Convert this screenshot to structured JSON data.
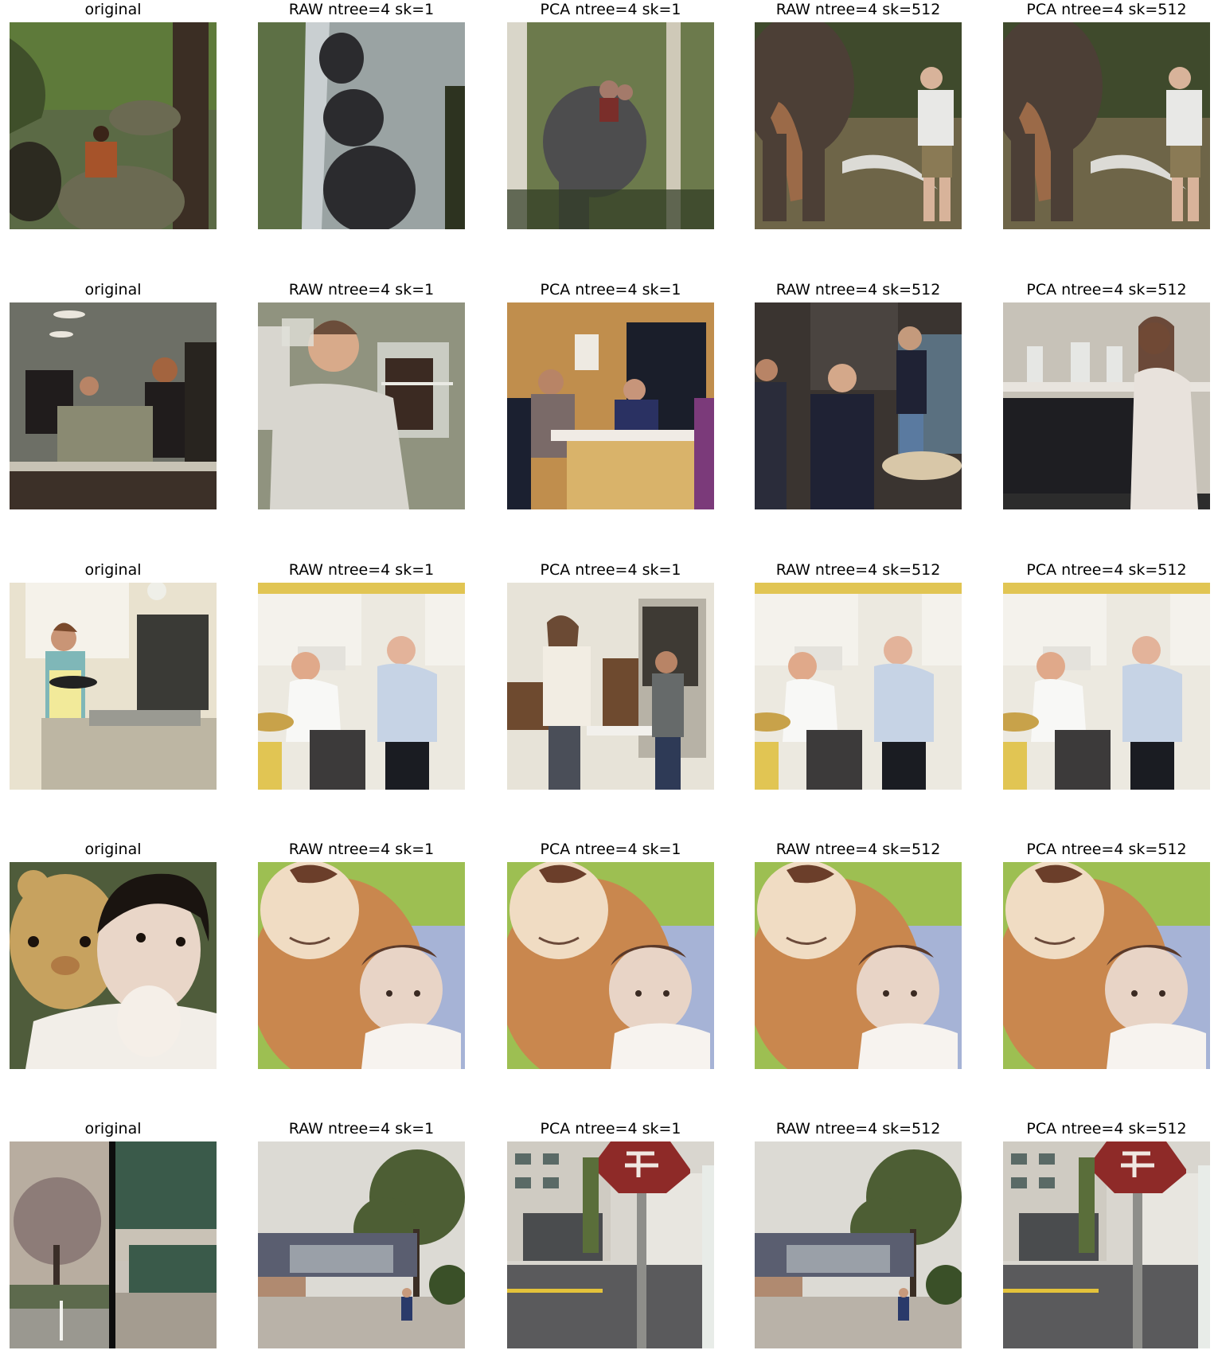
{
  "figure": {
    "rows": [
      {
        "cells": [
          {
            "title": "original",
            "scene": "elephant-river-rider",
            "palette": [
              "#5e7a3a",
              "#3f4f2a",
              "#6b6a52",
              "#a6532a"
            ]
          },
          {
            "title": "RAW ntree=4 sk=1",
            "scene": "bears-river",
            "palette": [
              "#9aa3a3",
              "#2b2b2e",
              "#5d7045",
              "#c9cfd1"
            ]
          },
          {
            "title": "PCA ntree=4 sk=1",
            "scene": "elephant-forest-riders",
            "palette": [
              "#6c7a4c",
              "#4d4d4e",
              "#2f3a24",
              "#a47a6a"
            ]
          },
          {
            "title": "RAW ntree=4 sk=512",
            "scene": "elephant-man-pond",
            "palette": [
              "#6e6548",
              "#4c3f36",
              "#e8e8e6",
              "#8a7a55"
            ]
          },
          {
            "title": "PCA ntree=4 sk=512",
            "scene": "elephant-man-pond",
            "palette": [
              "#6e6548",
              "#4c3f36",
              "#e8e8e6",
              "#8a7a55"
            ]
          }
        ]
      },
      {
        "cells": [
          {
            "title": "original",
            "scene": "kitchen-counter",
            "palette": [
              "#6d6f66",
              "#201c1c",
              "#c8c3b5",
              "#3c3028"
            ]
          },
          {
            "title": "RAW ntree=4 sk=1",
            "scene": "man-drinking",
            "palette": [
              "#90937f",
              "#d8d6cf",
              "#6b4d3a",
              "#3b2a22"
            ]
          },
          {
            "title": "PCA ntree=4 sk=1",
            "scene": "wood-kitchen-party",
            "palette": [
              "#c08e4d",
              "#d9b36a",
              "#1a1e2a",
              "#7a6a68"
            ]
          },
          {
            "title": "RAW ntree=4 sk=512",
            "scene": "group-indoor",
            "palette": [
              "#3a3430",
              "#1f2234",
              "#9b8a7a",
              "#d8c7a8"
            ]
          },
          {
            "title": "PCA ntree=4 sk=512",
            "scene": "woman-oven",
            "palette": [
              "#c7c2b8",
              "#1e1e22",
              "#e8e2dc",
              "#6b5d52"
            ]
          }
        ]
      },
      {
        "cells": [
          {
            "title": "original",
            "scene": "woman-white-kitchen",
            "palette": [
              "#e9e2cf",
              "#bdb6a3",
              "#7fb7b8",
              "#d6d3c7"
            ]
          },
          {
            "title": "RAW ntree=4 sk=1",
            "scene": "couple-yellow-kitchen",
            "palette": [
              "#ece9e0",
              "#e1c553",
              "#3c3a3a",
              "#c6d3e5"
            ]
          },
          {
            "title": "PCA ntree=4 sk=1",
            "scene": "girl-drinking-room",
            "palette": [
              "#e7e3d8",
              "#6e4a2f",
              "#f2ede3",
              "#666a6a"
            ]
          },
          {
            "title": "RAW ntree=4 sk=512",
            "scene": "couple-yellow-kitchen",
            "palette": [
              "#ece9e0",
              "#e1c553",
              "#3c3a3a",
              "#c6d3e5"
            ]
          },
          {
            "title": "PCA ntree=4 sk=512",
            "scene": "couple-yellow-kitchen",
            "palette": [
              "#ece9e0",
              "#e1c553",
              "#3c3a3a",
              "#c6d3e5"
            ]
          }
        ]
      },
      {
        "cells": [
          {
            "title": "original",
            "scene": "baby-teddy-small",
            "palette": [
              "#c7a25f",
              "#e9d6c8",
              "#4f5c3b",
              "#f2eee8"
            ]
          },
          {
            "title": "RAW ntree=4 sk=1",
            "scene": "baby-teddy-big",
            "palette": [
              "#c9874e",
              "#f0dcc3",
              "#9dbf52",
              "#e8d4c6"
            ]
          },
          {
            "title": "PCA ntree=4 sk=1",
            "scene": "baby-teddy-big",
            "palette": [
              "#c9874e",
              "#f0dcc3",
              "#9dbf52",
              "#e8d4c6"
            ]
          },
          {
            "title": "RAW ntree=4 sk=512",
            "scene": "baby-teddy-big",
            "palette": [
              "#c9874e",
              "#f0dcc3",
              "#9dbf52",
              "#e8d4c6"
            ]
          },
          {
            "title": "PCA ntree=4 sk=512",
            "scene": "baby-teddy-big",
            "palette": [
              "#c9874e",
              "#f0dcc3",
              "#9dbf52",
              "#e8d4c6"
            ]
          }
        ]
      },
      {
        "cells": [
          {
            "title": "original",
            "scene": "split-tree-building",
            "palette": [
              "#8d7c78",
              "#3a5a4a",
              "#c9c2b6",
              "#9a9890"
            ]
          },
          {
            "title": "RAW ntree=4 sk=1",
            "scene": "campus-path",
            "palette": [
              "#dcdad4",
              "#4d5e34",
              "#b9b2a8",
              "#5a5e70"
            ]
          },
          {
            "title": "PCA ntree=4 sk=1",
            "scene": "stop-sign-street",
            "palette": [
              "#d9d6cf",
              "#8e2a28",
              "#5a5a5c",
              "#8e8e8a"
            ]
          },
          {
            "title": "RAW ntree=4 sk=512",
            "scene": "campus-path",
            "palette": [
              "#dcdad4",
              "#4d5e34",
              "#b9b2a8",
              "#5a5e70"
            ]
          },
          {
            "title": "PCA ntree=4 sk=512",
            "scene": "stop-sign-street",
            "palette": [
              "#d9d6cf",
              "#8e2a28",
              "#5a5a5c",
              "#8e8e8a"
            ]
          }
        ]
      }
    ]
  }
}
